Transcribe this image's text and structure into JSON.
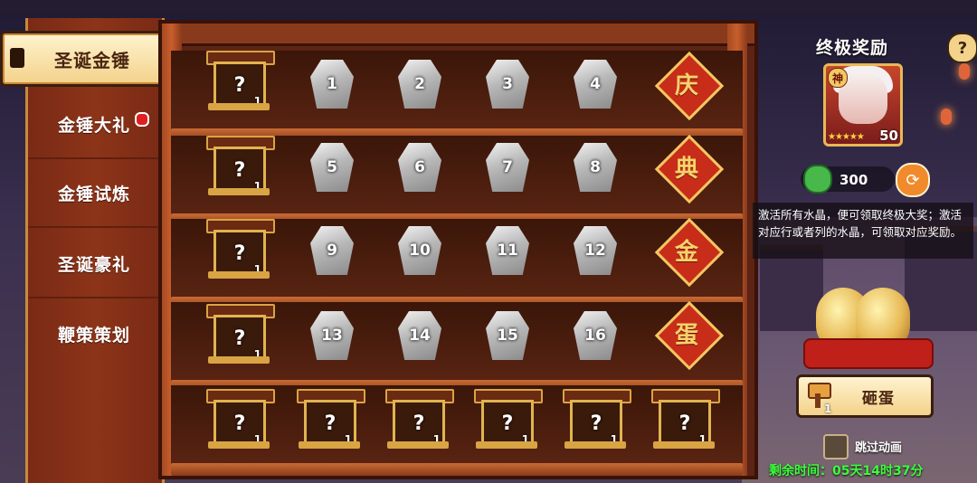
{
  "side_menu": {
    "selected": "圣诞金锤",
    "items": [
      {
        "label": "金锤大礼",
        "has_dot": true
      },
      {
        "label": "金锤试炼",
        "has_dot": false
      },
      {
        "label": "圣诞豪礼",
        "has_dot": false
      },
      {
        "label": "鞭策策划",
        "has_dot": false
      }
    ]
  },
  "grid": {
    "rows": [
      {
        "box_label": "?",
        "box_count": "1",
        "crystals": [
          "1",
          "2",
          "3",
          "4"
        ],
        "char": "庆"
      },
      {
        "box_label": "?",
        "box_count": "1",
        "crystals": [
          "5",
          "6",
          "7",
          "8"
        ],
        "char": "典"
      },
      {
        "box_label": "?",
        "box_count": "1",
        "crystals": [
          "9",
          "10",
          "11",
          "12"
        ],
        "char": "金"
      },
      {
        "box_label": "?",
        "box_count": "1",
        "crystals": [
          "13",
          "14",
          "15",
          "16"
        ],
        "char": "蛋"
      }
    ],
    "bottom_boxes": [
      {
        "label": "?",
        "count": "1"
      },
      {
        "label": "?",
        "count": "1"
      },
      {
        "label": "?",
        "count": "1"
      },
      {
        "label": "?",
        "count": "1"
      },
      {
        "label": "?",
        "count": "1"
      },
      {
        "label": "?",
        "count": "1"
      }
    ]
  },
  "reward": {
    "title": "终极奖励",
    "help": "?",
    "hero_badge": "神",
    "hero_stars": "★★★★★",
    "hero_level": "50",
    "currency_value": "300",
    "description": "激活所有水晶，便可领取终极大奖；激活对应行或者列的水晶，可领取对应奖励。",
    "smash_label": "砸蛋",
    "hammer_count": "1",
    "skip_label": "跳过动画",
    "time_left": "剩余时间：05天14时37分"
  },
  "colors": {
    "accent_gold": "#e7b955",
    "shelf_wood": "#5b2414",
    "tile_red": "#c82d1a",
    "timer_green": "#3cff3c"
  }
}
